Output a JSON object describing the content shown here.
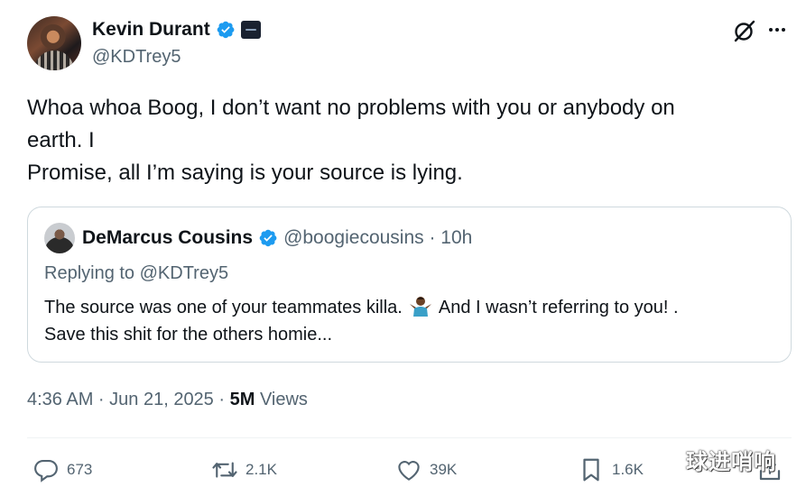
{
  "author": {
    "name": "Kevin Durant",
    "handle": "@KDTrey5"
  },
  "tweet": {
    "lines": [
      "Whoa whoa Boog, I don’t want no problems with you or anybody on",
      "earth. I",
      "Promise, all I’m saying is your source is lying."
    ]
  },
  "quote": {
    "name": "DeMarcus Cousins",
    "handle_time": "@boogiecousins · 10h",
    "replying_to": "Replying to @KDTrey5",
    "line1_a": "The source was one of your teammates killa.",
    "line1_b": "And I wasn’t referring to you! .",
    "line2": "Save this shit for the others homie..."
  },
  "meta": {
    "timestamp": "4:36 AM · Jun 21, 2025 · ",
    "views_count": "5M",
    "views_label": " Views"
  },
  "actions": {
    "replies": "673",
    "reposts": "2.1K",
    "likes": "39K",
    "bookmarks": "1.6K"
  },
  "watermark": "球进哨响",
  "colors": {
    "text": "#0f1419",
    "secondary": "#536471",
    "verified": "#1d9bf0",
    "border": "#cfd9de"
  },
  "icons": [
    "verified-badge-icon",
    "affiliate-badge-icon",
    "grok-icon",
    "more-icon",
    "reply-icon",
    "repost-icon",
    "like-icon",
    "bookmark-icon",
    "share-icon",
    "person-shrugging-emoji"
  ]
}
